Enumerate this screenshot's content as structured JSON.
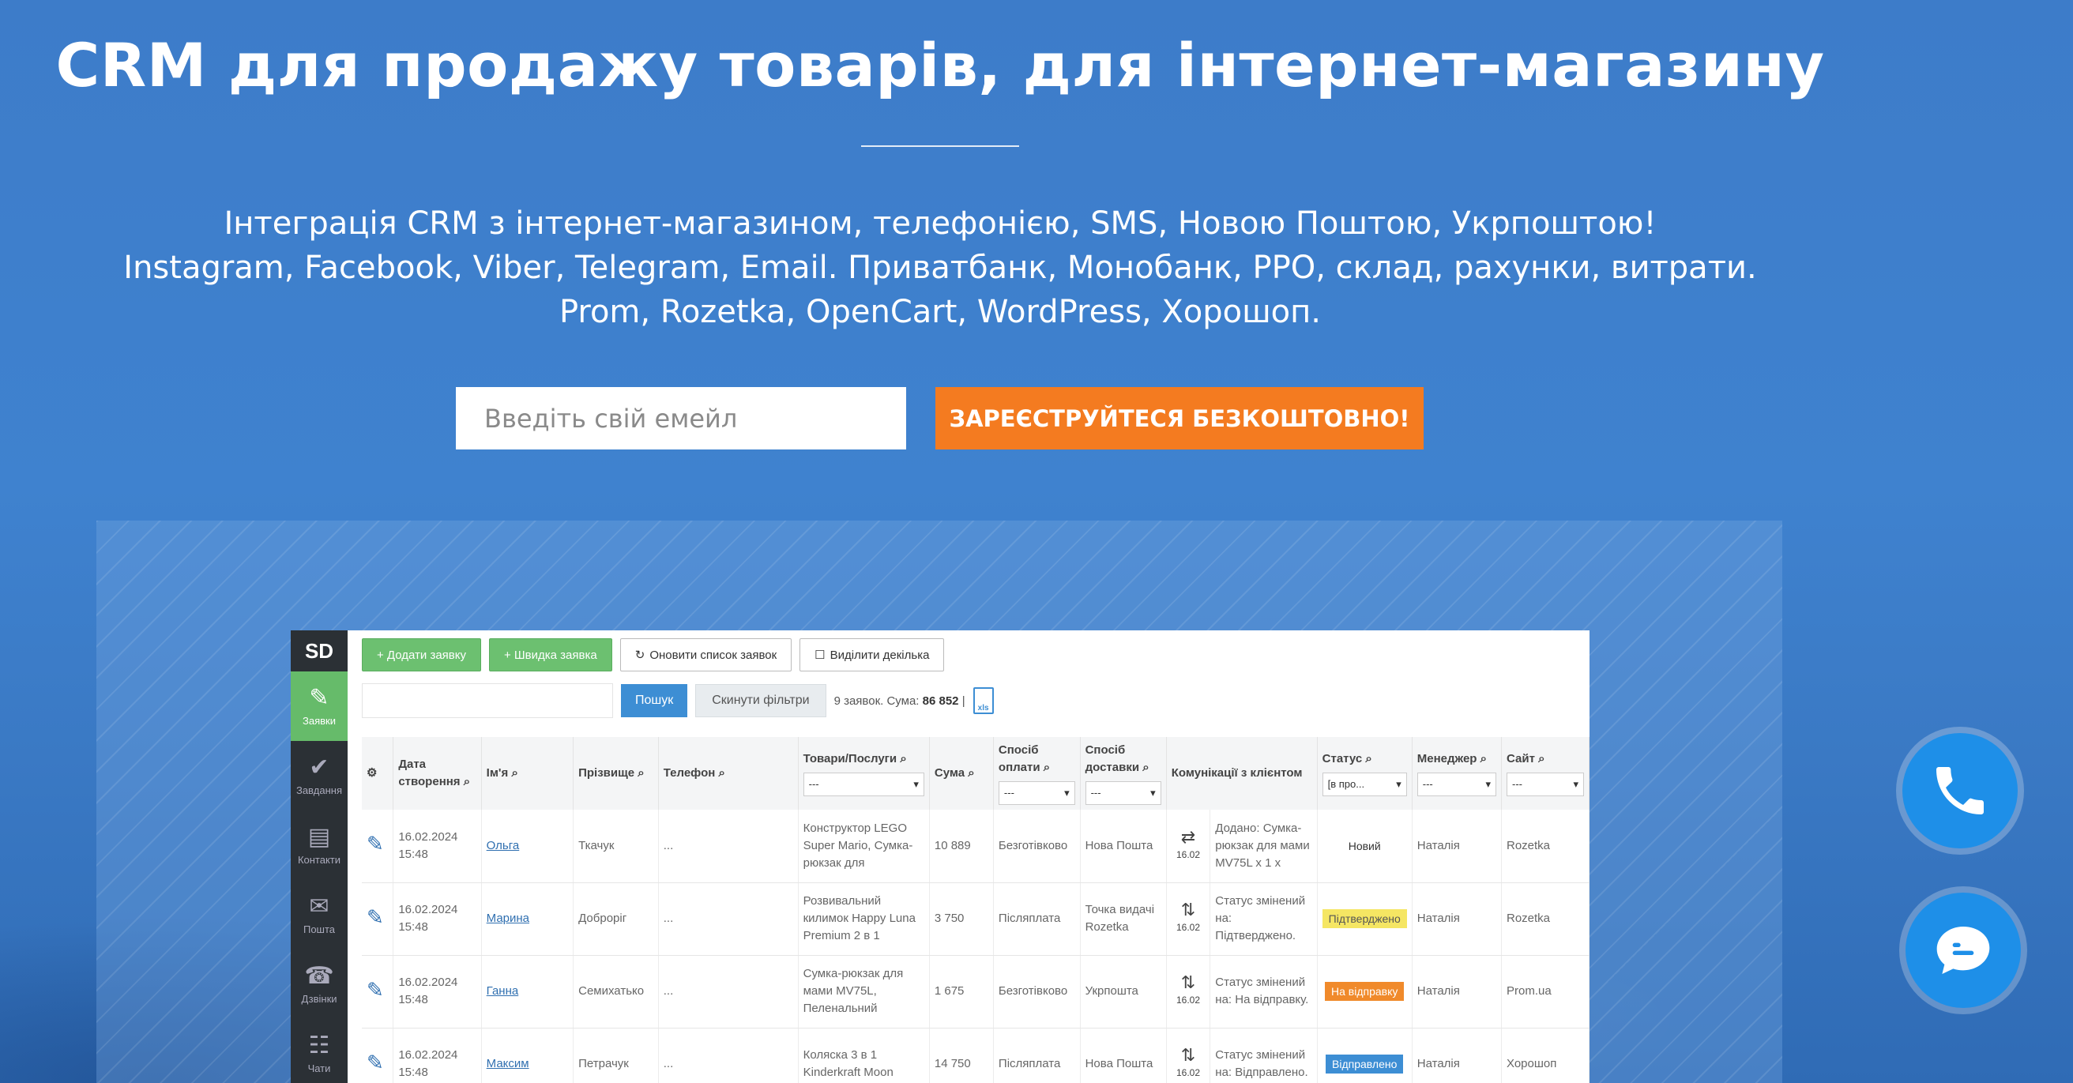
{
  "hero": {
    "title": "CRM для продажу товарів, для інтернет-магазину",
    "subtitle_lines": [
      "Інтеграція CRM з інтернет-магазином, телефонією, SMS, Новою Поштою, Укрпоштою!",
      "Instagram, Facebook, Viber, Telegram, Email. Приватбанк, Монобанк, РРО, склад, рахунки, витрати.",
      "Prom, Rozetka, OpenCart, WordPress, Хорошоп."
    ]
  },
  "signup": {
    "email_placeholder": "Введіть свій емейл",
    "cta_label": "ЗАРЕЄСТРУЙТЕСЯ БЕЗКОШТОВНО!"
  },
  "colors": {
    "cta": "#f47b20",
    "background": "#3f82cf",
    "fab": "#1e8fe8",
    "sidebar_active": "#66bb6a"
  },
  "app": {
    "logo": "SD",
    "sidebar": [
      {
        "label": "Заявки",
        "icon": "document-edit-icon",
        "active": true
      },
      {
        "label": "Завдання",
        "icon": "check-circle-icon",
        "active": false
      },
      {
        "label": "Контакти",
        "icon": "contact-card-icon",
        "active": false
      },
      {
        "label": "Пошта",
        "icon": "mail-icon",
        "active": false
      },
      {
        "label": "Дзвінки",
        "icon": "phone-icon",
        "active": false
      },
      {
        "label": "Чати",
        "icon": "chat-icon",
        "active": false
      }
    ],
    "toolbar": {
      "add_order": "+ Додати заявку",
      "quick_order": "+ Швидка заявка",
      "refresh": "Оновити список заявок",
      "select_multiple": "Виділити декілька"
    },
    "search": {
      "find": "Пошук",
      "reset": "Скинути фільтри",
      "summary_prefix": "9 заявок. Сума: ",
      "summary_total": "86 852",
      "summary_sep": "|"
    },
    "columns": {
      "created": "Дата створення",
      "name": "Ім'я",
      "surname": "Прізвище",
      "phone": "Телефон",
      "products": "Товари/Послуги",
      "sum": "Сума",
      "payment": "Спосіб оплати",
      "delivery": "Спосіб доставки",
      "comms": "Комунікації з клієнтом",
      "status": "Статус",
      "manager": "Менеджер",
      "site": "Сайт"
    },
    "filters": {
      "products": "---",
      "payment": "---",
      "delivery": "---",
      "status": "[в про...",
      "manager": "---",
      "site": "---"
    },
    "rows": [
      {
        "date": "16.02.2024",
        "time": "15:48",
        "name": "Ольга",
        "surname": "Ткачук",
        "phone": "...",
        "products": "Конструктор LEGO Super Mario, Сумка-рюкзак для",
        "sum": "10 889",
        "payment": "Безготівково",
        "delivery": "Нова Пошта",
        "comm_date": "16.02",
        "comm": "Додано: Сумка-рюкзак для мами MV75L x 1 x",
        "status": "Новий",
        "status_style": "plain",
        "manager": "Наталія",
        "site": "Rozetka"
      },
      {
        "date": "16.02.2024",
        "time": "15:48",
        "name": "Марина",
        "surname": "Доброріг",
        "phone": "...",
        "products": "Розвивальний килимок Happy Luna Premium 2 в 1",
        "sum": "3 750",
        "payment": "Післяплата",
        "delivery": "Точка видачі Rozetka",
        "comm_date": "16.02",
        "comm": "Статус змінений на: Підтверджено.",
        "status": "Підтверджено",
        "status_style": "yellow",
        "manager": "Наталія",
        "site": "Rozetka"
      },
      {
        "date": "16.02.2024",
        "time": "15:48",
        "name": "Ганна",
        "surname": "Семихатько",
        "phone": "...",
        "products": "Сумка-рюкзак для мами MV75L, Пеленальний",
        "sum": "1 675",
        "payment": "Безготівково",
        "delivery": "Укрпошта",
        "comm_date": "16.02",
        "comm": "Статус змінений на: На відправку.",
        "status": "На відправку",
        "status_style": "orange",
        "manager": "Наталія",
        "site": "Prom.ua"
      },
      {
        "date": "16.02.2024",
        "time": "15:48",
        "name": "Максим",
        "surname": "Петрачук",
        "phone": "...",
        "products": "Коляска 3 в 1 Kinderkraft Moon",
        "sum": "14 750",
        "payment": "Післяплата",
        "delivery": "Нова Пошта",
        "comm_date": "16.02",
        "comm": "Статус змінений на: Відправлено.",
        "status": "Відправлено",
        "status_style": "blue",
        "manager": "Наталія",
        "site": "Хорошоп"
      }
    ]
  },
  "fabs": [
    {
      "icon": "phone-icon"
    },
    {
      "icon": "chat-bubble-icon"
    }
  ]
}
